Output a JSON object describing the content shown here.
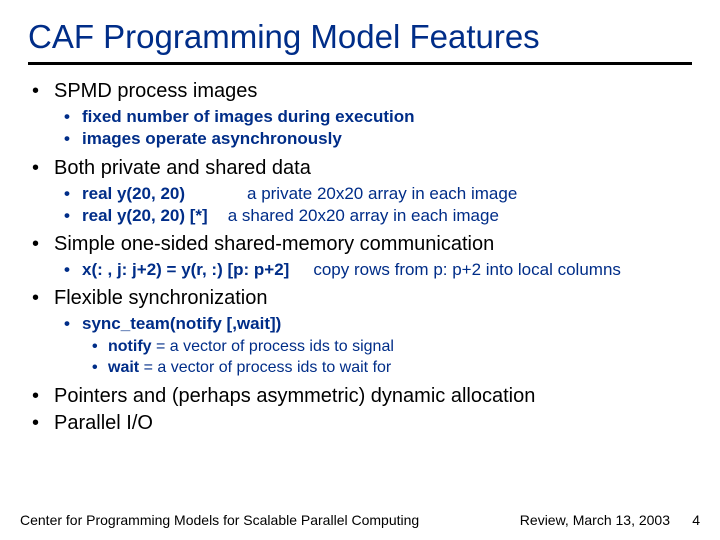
{
  "title": "CAF Programming Model Features",
  "bullets": {
    "b1": "SPMD process images",
    "b1_1": "fixed number of images during execution",
    "b1_2": "images operate asynchronously",
    "b2": "Both private and shared data",
    "b2_1a": "real y(20, 20)",
    "b2_1b": "a private 20x20 array in each image",
    "b2_2a": "real y(20, 20) [*]",
    "b2_2b": "a shared 20x20 array in each image",
    "b3": "Simple one-sided shared-memory communication",
    "b3_1a": "x(: , j: j+2) = y(r, :) [p: p+2]",
    "b3_1b": "copy rows from p: p+2 into local columns",
    "b4": "Flexible synchronization",
    "b4_1": "sync_team(notify [,wait])",
    "b4_1_1a": "notify",
    "b4_1_1b": " = a vector of process ids to signal",
    "b4_1_2a": "wait",
    "b4_1_2b": " = a vector of process ids to wait for",
    "b5": "Pointers and (perhaps asymmetric) dynamic allocation",
    "b6": "Parallel I/O"
  },
  "footer": {
    "left": "Center for Programming Models for Scalable Parallel Computing",
    "right": "Review, March 13, 2003",
    "num": "4"
  }
}
